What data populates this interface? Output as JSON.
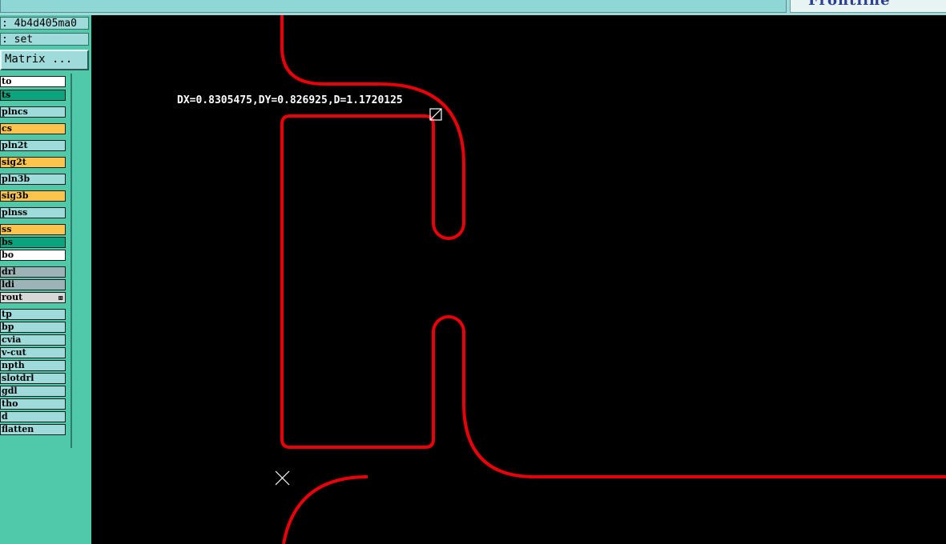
{
  "window": {
    "top_field_value": "",
    "logo_text": "Frontline"
  },
  "info": {
    "job_line": ": 4b4d405ma0",
    "step_line": ": set",
    "matrix_button": "Matrix ..."
  },
  "layers": [
    {
      "label": "to",
      "color": "#ffffff"
    },
    {
      "label": "ts",
      "color": "#0aa57f"
    },
    {
      "label": "plncs",
      "color": "#9fdbdb"
    },
    {
      "label": "cs",
      "color": "#fcc44a"
    },
    {
      "label": "pln2t",
      "color": "#9fdbdb"
    },
    {
      "label": "sig2t",
      "color": "#fcc44a"
    },
    {
      "label": "pln3b",
      "color": "#9fdbdb"
    },
    {
      "label": "sig3b",
      "color": "#fcc44a"
    },
    {
      "label": "plnss",
      "color": "#9fdbdb"
    },
    {
      "label": "ss",
      "color": "#fcc44a"
    },
    {
      "label": "bs",
      "color": "#0aa57f"
    },
    {
      "label": "bo",
      "color": "#ffffff"
    },
    {
      "label": "drl",
      "color": "#9cb4b8"
    },
    {
      "label": "ldi",
      "color": "#9cb4b8"
    },
    {
      "label": "rout",
      "color": "#d8d8d8",
      "mark": "⊞"
    },
    {
      "label": "tp",
      "color": "#9fdbdb"
    },
    {
      "label": "bp",
      "color": "#9fdbdb"
    },
    {
      "label": "cvia",
      "color": "#9fdbdb"
    },
    {
      "label": "v-cut",
      "color": "#9fdbdb"
    },
    {
      "label": "npth",
      "color": "#9fdbdb"
    },
    {
      "label": "slotdrl",
      "color": "#9fdbdb"
    },
    {
      "label": "gdl",
      "color": "#9fdbdb"
    },
    {
      "label": "tho",
      "color": "#9fdbdb"
    },
    {
      "label": "d",
      "color": "#9fdbdb"
    },
    {
      "label": "flatten",
      "color": "#9fdbdb"
    }
  ],
  "canvas": {
    "measurement": "DX=0.8305475,DY=0.826925,D=1.1720125",
    "profile_color": "#e8000b"
  }
}
